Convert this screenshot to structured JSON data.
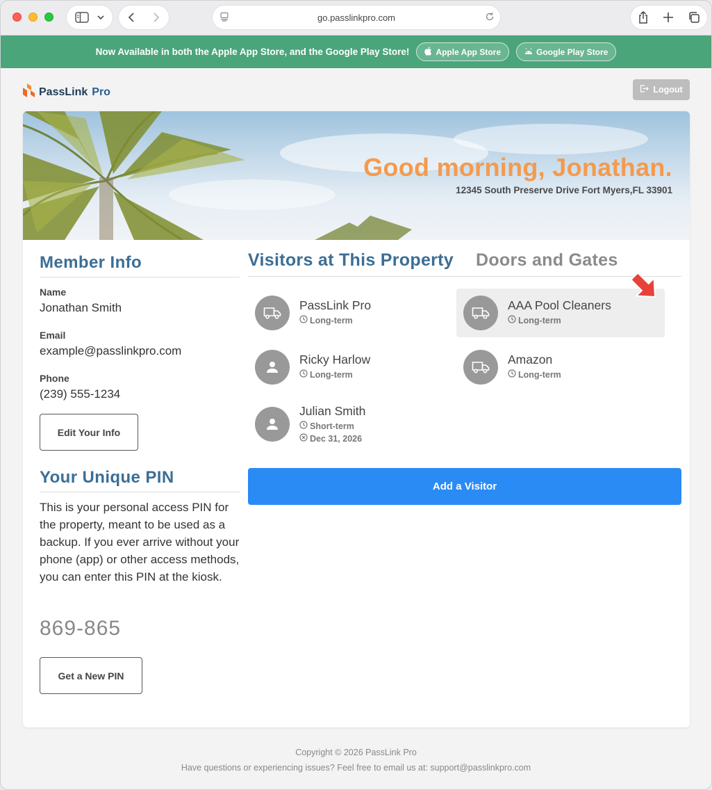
{
  "browser": {
    "url": "go.passlinkpro.com"
  },
  "banner": {
    "text": "Now Available in both the Apple App Store, and the Google Play Store!",
    "apple_label": "Apple App Store",
    "google_label": "Google Play Store"
  },
  "header": {
    "logo_brand": "PassLink",
    "logo_pro": "Pro",
    "logout_label": "Logout"
  },
  "hero": {
    "greeting": "Good morning, Jonathan.",
    "address": "12345 South Preserve Drive Fort Myers,FL 33901"
  },
  "member": {
    "title": "Member Info",
    "name_label": "Name",
    "name": "Jonathan Smith",
    "email_label": "Email",
    "email": "example@passlinkpro.com",
    "phone_label": "Phone",
    "phone": "(239) 555-1234",
    "edit_label": "Edit Your Info"
  },
  "pin": {
    "title": "Your Unique PIN",
    "description": "This is your personal access PIN for the property, meant to be used as a backup. If you ever arrive without your phone (app) or other access methods, you can enter this PIN at the kiosk.",
    "value": "869-865",
    "new_pin_label": "Get a New PIN"
  },
  "tabs": {
    "visitors": "Visitors at This Property",
    "doors": "Doors and Gates"
  },
  "visitors": [
    {
      "name": "PassLink Pro",
      "icon": "truck-icon",
      "term": "Long-term"
    },
    {
      "name": "AAA Pool Cleaners",
      "icon": "truck-icon",
      "term": "Long-term",
      "highlighted": true
    },
    {
      "name": "Ricky Harlow",
      "icon": "person-icon",
      "term": "Long-term"
    },
    {
      "name": "Amazon",
      "icon": "truck-icon",
      "term": "Long-term"
    },
    {
      "name": "Julian Smith",
      "icon": "person-icon",
      "term": "Short-term",
      "expires": "Dec 31, 2026"
    }
  ],
  "add_visitor_label": "Add a Visitor",
  "footer": {
    "copyright": "Copyright © 2026 PassLink Pro",
    "support_prefix": "Have questions or experiencing issues? Feel free to email us at: ",
    "support_email": "support@passlinkpro.com"
  },
  "colors": {
    "banner": "#4aa57a",
    "accent_blue": "#2a8bf5",
    "heading_blue": "#3b6e95",
    "greeting_orange": "#f49a4e"
  }
}
